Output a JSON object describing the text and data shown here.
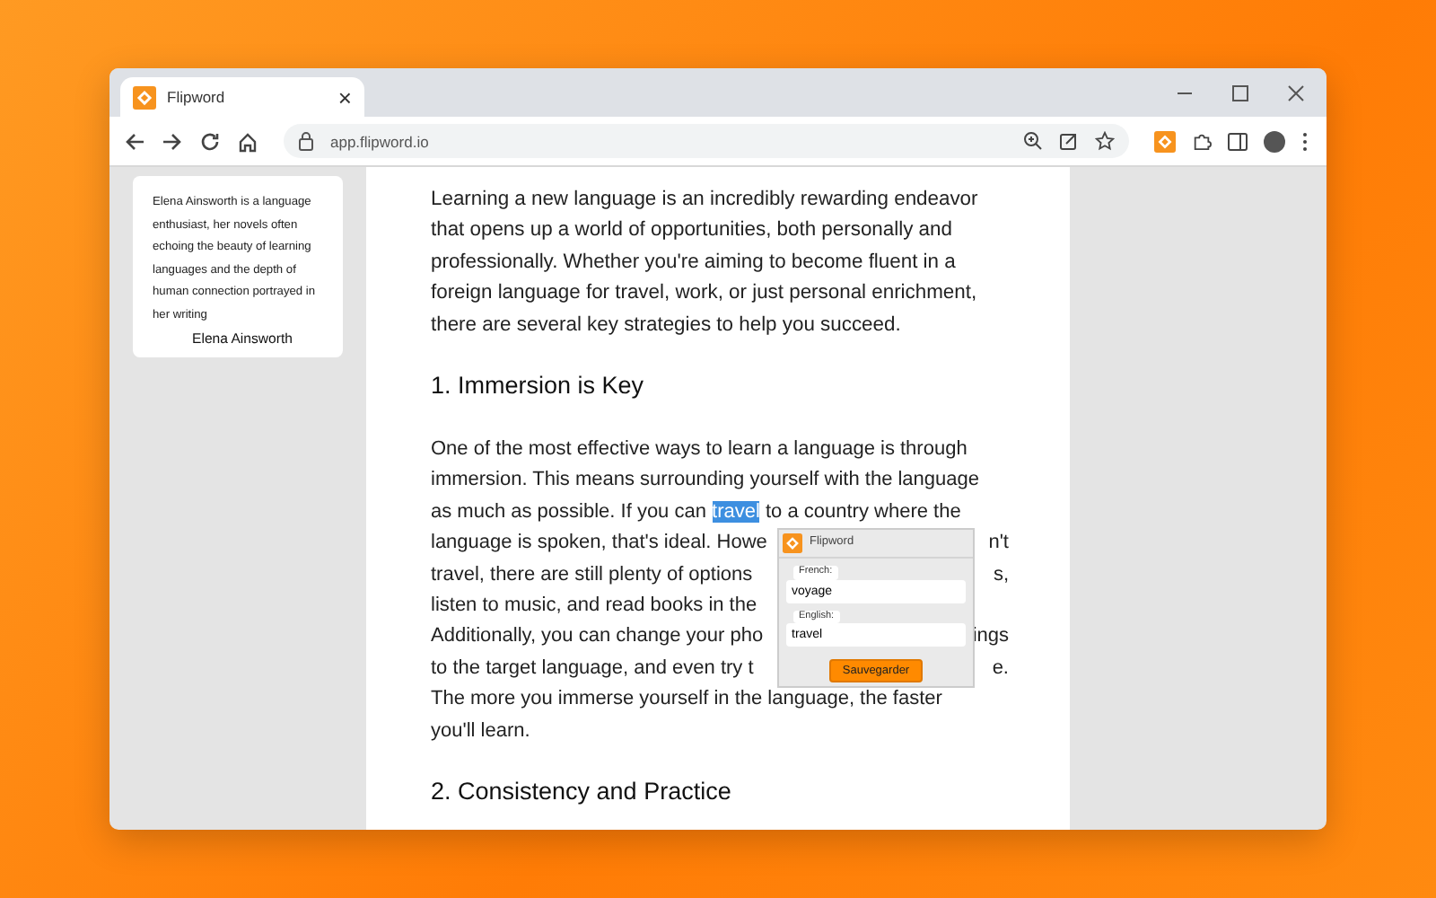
{
  "browser": {
    "tab": {
      "title": "Flipword",
      "close": "×"
    },
    "url": "app.flipword.io"
  },
  "sidebar_card": {
    "bio": "Elena Ainsworth is a language enthusiast, her novels often echoing the beauty of learning languages and the depth of human connection portrayed in her writing",
    "author": "Elena Ainsworth"
  },
  "article": [
    {
      "kind": "paragraph",
      "lines": [
        "Learning a new language is an incredibly rewarding endeavor",
        "that opens up a world of opportunities, both personally and",
        "professionally. Whether you're aiming to become fluent in a",
        "foreign language for travel, work, or just personal enrichment,",
        "there are several key strategies to help you succeed."
      ]
    },
    {
      "kind": "heading",
      "text": "1. Immersion is Key"
    },
    {
      "kind": "covered_paragraph",
      "lines": [
        {
          "parts": [
            {
              "text": "One of the most effective ways to learn a language is through",
              "highlighted": false
            }
          ]
        },
        {
          "parts": [
            {
              "text": "immersion. This means surrounding yourself with the language",
              "highlighted": false
            }
          ]
        },
        {
          "parts": [
            {
              "text": "as much as possible. If you can ",
              "highlighted": false
            },
            {
              "text": "travel",
              "highlighted": true
            },
            {
              "text": " to a country where the",
              "highlighted": false
            }
          ]
        },
        {
          "parts": [
            {
              "text": "language is spoken, that's ideal. Howe",
              "highlighted": false
            }
          ],
          "tail": "n't"
        },
        {
          "parts": [
            {
              "text": "travel, there are still plenty of options",
              "highlighted": false
            }
          ],
          "tail": "s,"
        },
        {
          "parts": [
            {
              "text": "listen to music, and read books in the",
              "highlighted": false
            }
          ]
        },
        {
          "parts": [
            {
              "text": "Additionally, you can change your pho",
              "highlighted": false
            }
          ],
          "tail": "ings"
        },
        {
          "parts": [
            {
              "text": "to the target language, and even try t",
              "highlighted": false
            }
          ],
          "tail": "e."
        },
        {
          "parts": [
            {
              "text": "The more you immerse yourself in the language, the faster",
              "highlighted": false
            }
          ]
        },
        {
          "parts": [
            {
              "text": "you'll learn.",
              "highlighted": false
            }
          ]
        }
      ]
    },
    {
      "kind": "heading",
      "text": "2. Consistency and Practice"
    }
  ],
  "popup": {
    "title": "Flipword",
    "fields": [
      {
        "label": "French:",
        "value": "voyage"
      },
      {
        "label": "English:",
        "value": "travel"
      }
    ],
    "button": "Sauvegarder"
  }
}
